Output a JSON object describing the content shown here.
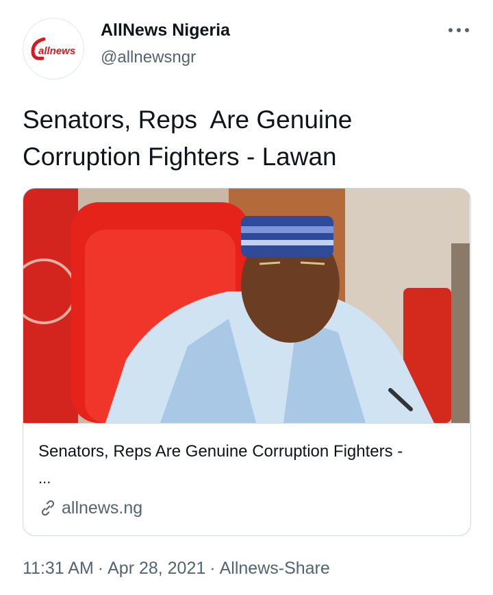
{
  "author": {
    "avatar_text": "allnews",
    "display_name": "AllNews Nigeria",
    "handle": "@allnewsngr"
  },
  "tweet": {
    "text": "Senators, Reps  Are Genuine\nCorruption Fighters - Lawan"
  },
  "card": {
    "title": "Senators, Reps Are Genuine Corruption Fighters -",
    "ellipsis": "...",
    "domain": "allnews.ng"
  },
  "meta": {
    "time": "11:31 AM",
    "date": "Apr 28, 2021",
    "source": "Allnews-Share"
  },
  "icons": {
    "more": "more-horizontal-icon",
    "link": "link-icon"
  },
  "colors": {
    "text_primary": "#0f1419",
    "text_secondary": "#536471",
    "border": "#cfd9de",
    "brand_red": "#d71920"
  }
}
